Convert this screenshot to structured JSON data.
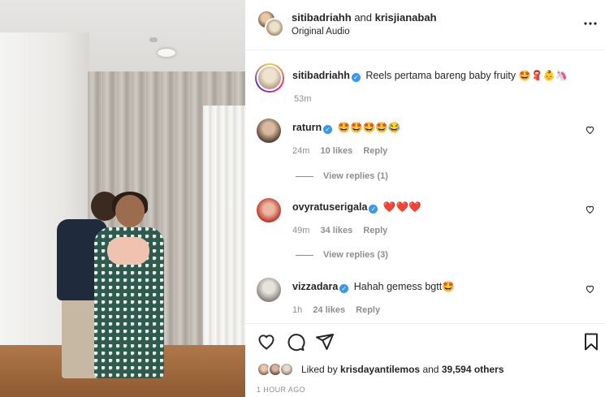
{
  "header": {
    "user1": "sitibadriahh",
    "and": "and",
    "user2": "krisjianabah",
    "audio": "Original Audio",
    "more_icon": "more-horizontal-icon"
  },
  "caption": {
    "username": "sitibadriahh",
    "text": "Reels pertama bareng baby fruity",
    "emojis": "🤩🧣👶🦄",
    "time": "53m"
  },
  "comments": [
    {
      "username": "raturn",
      "text": "🤩🤩🤩🤩😂",
      "time": "24m",
      "likes": "10 likes",
      "reply": "Reply",
      "view_replies": "View replies (1)"
    },
    {
      "username": "ovyratuserigala",
      "text": "❤️❤️❤️",
      "time": "49m",
      "likes": "34 likes",
      "reply": "Reply",
      "view_replies": "View replies (3)"
    },
    {
      "username": "vizzadara",
      "text": "Hahah gemess bgtt🤩",
      "time": "1h",
      "likes": "24 likes",
      "reply": "Reply"
    }
  ],
  "likes": {
    "prefix": "Liked by",
    "user": "krisdayantilemos",
    "middle": "and",
    "others": "39,594 others"
  },
  "timestamp": "1 HOUR AGO",
  "colors": {
    "verified": "#3897f0",
    "secondary_text": "#8e8e8e",
    "text": "#262626"
  }
}
